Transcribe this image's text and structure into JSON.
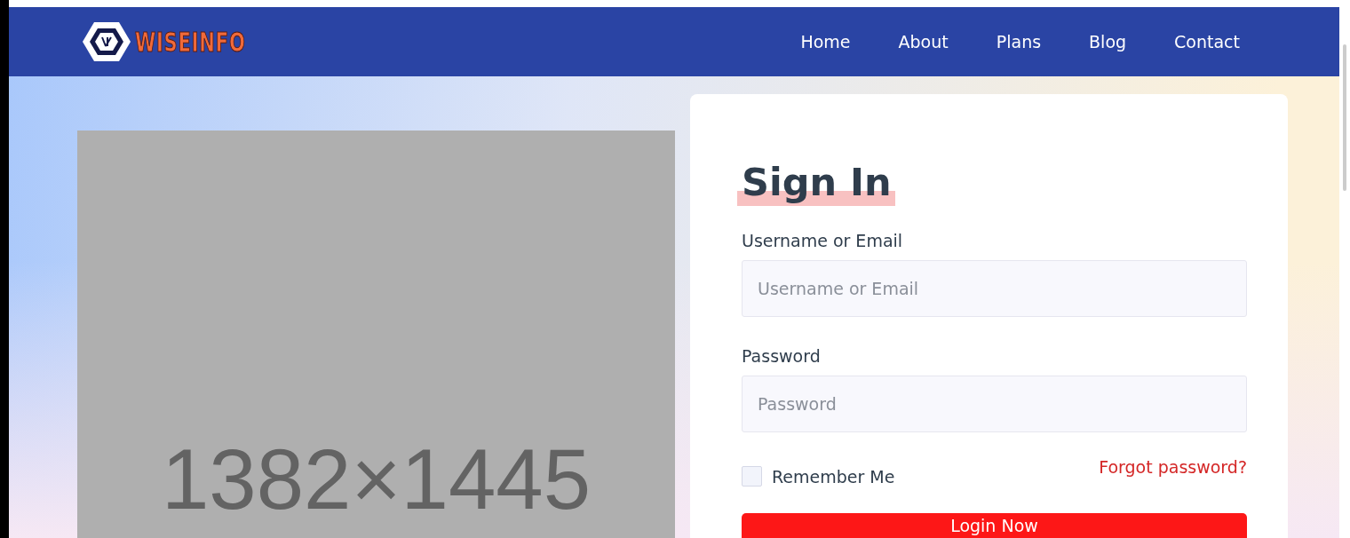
{
  "header": {
    "logo_text": "WISEINFO",
    "nav": [
      {
        "label": "Home"
      },
      {
        "label": "About"
      },
      {
        "label": "Plans"
      },
      {
        "label": "Blog"
      },
      {
        "label": "Contact"
      }
    ]
  },
  "image_placeholder": {
    "text": "1382×1445"
  },
  "login": {
    "title": "Sign In",
    "fields": [
      {
        "label": "Username or Email",
        "placeholder": "Username or Email"
      },
      {
        "label": "Password",
        "placeholder": "Password"
      }
    ],
    "remember": {
      "label": "Remember Me",
      "checked": false
    },
    "forgot_link": "Forgot password?",
    "submit": "Login Now"
  }
}
